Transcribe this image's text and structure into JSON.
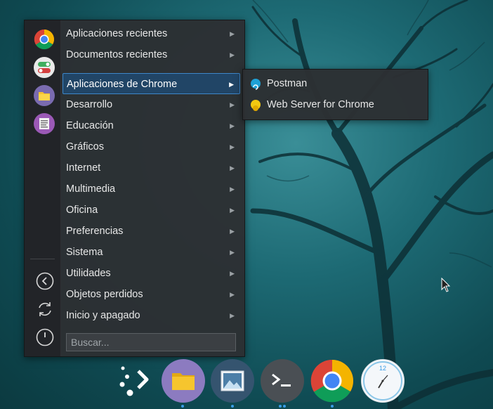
{
  "menu": {
    "items": [
      {
        "label": "Aplicaciones recientes"
      },
      {
        "label": "Documentos recientes"
      },
      {
        "label": "Aplicaciones de Chrome"
      },
      {
        "label": "Desarrollo"
      },
      {
        "label": "Educación"
      },
      {
        "label": "Gráficos"
      },
      {
        "label": "Internet"
      },
      {
        "label": "Multimedia"
      },
      {
        "label": "Oficina"
      },
      {
        "label": "Preferencias"
      },
      {
        "label": "Sistema"
      },
      {
        "label": "Utilidades"
      },
      {
        "label": "Objetos perdidos"
      },
      {
        "label": "Inicio y apagado"
      }
    ],
    "active_index": 2,
    "search_placeholder": "Buscar..."
  },
  "submenu": {
    "items": [
      {
        "label": "Postman",
        "icon": "postman-icon"
      },
      {
        "label": "Web Server for Chrome",
        "icon": "web-server-icon"
      }
    ]
  },
  "sidebar": {
    "favorites": [
      "chrome-icon",
      "settings-toggle-icon",
      "files-folder-icon",
      "text-editor-icon"
    ],
    "system": [
      "back-icon",
      "refresh-icon",
      "power-icon"
    ]
  },
  "dock": {
    "items": [
      "launcher-icon",
      "file-manager-icon",
      "image-viewer-icon",
      "terminal-icon",
      "chrome-icon",
      "clock-icon"
    ],
    "clock_label": "12"
  },
  "colors": {
    "accent": "#3d86c9",
    "active_bg": "#214566",
    "menu_bg": "#2c3033"
  }
}
